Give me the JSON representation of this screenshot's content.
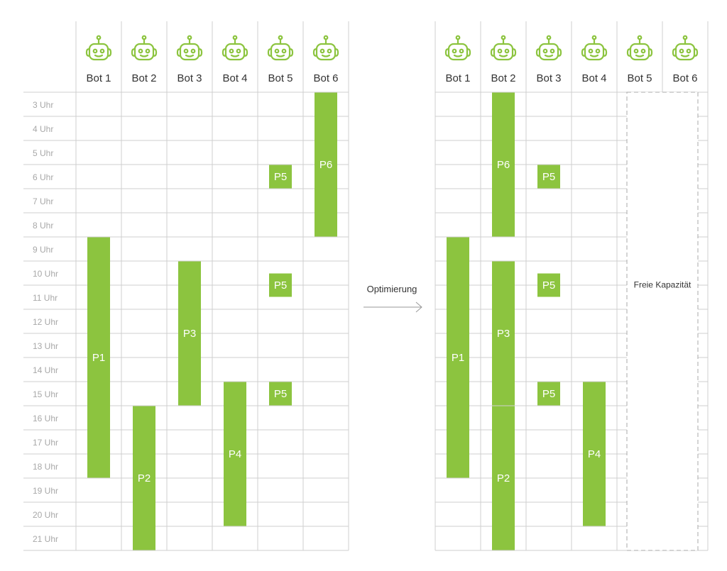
{
  "colors": {
    "accent": "#8cc43f",
    "grid": "#cfcfcf",
    "hour_text": "#a8a8a8"
  },
  "bots": [
    "Bot 1",
    "Bot 2",
    "Bot 3",
    "Bot 4",
    "Bot 5",
    "Bot 6"
  ],
  "bot_icon": "robot-icon",
  "hours": [
    "3 Uhr",
    "4 Uhr",
    "5 Uhr",
    "6 Uhr",
    "7 Uhr",
    "8 Uhr",
    "9 Uhr",
    "10 Uhr",
    "11 Uhr",
    "12 Uhr",
    "13 Uhr",
    "14 Uhr",
    "15 Uhr",
    "16 Uhr",
    "17 Uhr",
    "18 Uhr",
    "19 Uhr",
    "20 Uhr",
    "21 Uhr"
  ],
  "arrow_label": "Optimierung",
  "free_capacity_label": "Freie Kapazität",
  "before": {
    "tasks": [
      {
        "label": "P1",
        "bot": 1,
        "start": 9,
        "end": 19
      },
      {
        "label": "P2",
        "bot": 2,
        "start": 16,
        "end": 22
      },
      {
        "label": "P3",
        "bot": 3,
        "start": 10,
        "end": 16
      },
      {
        "label": "P4",
        "bot": 4,
        "start": 15,
        "end": 21
      },
      {
        "label": "P5",
        "bot": 5,
        "start": 6,
        "end": 7
      },
      {
        "label": "P5",
        "bot": 5,
        "start": 10.5,
        "end": 11.5
      },
      {
        "label": "P5",
        "bot": 5,
        "start": 15,
        "end": 16
      },
      {
        "label": "P6",
        "bot": 6,
        "start": 3,
        "end": 9
      }
    ]
  },
  "after": {
    "tasks": [
      {
        "label": "P1",
        "bot": 1,
        "start": 9,
        "end": 19
      },
      {
        "label": "P6",
        "bot": 2,
        "start": 3,
        "end": 9
      },
      {
        "label": "P3",
        "bot": 2,
        "start": 10,
        "end": 16
      },
      {
        "label": "P2",
        "bot": 2,
        "start": 16,
        "end": 22
      },
      {
        "label": "P5",
        "bot": 3,
        "start": 6,
        "end": 7
      },
      {
        "label": "P5",
        "bot": 3,
        "start": 10.5,
        "end": 11.5
      },
      {
        "label": "P5",
        "bot": 3,
        "start": 15,
        "end": 16
      },
      {
        "label": "P4",
        "bot": 4,
        "start": 15,
        "end": 21
      }
    ],
    "free_capacity_bots": [
      5,
      6
    ]
  }
}
